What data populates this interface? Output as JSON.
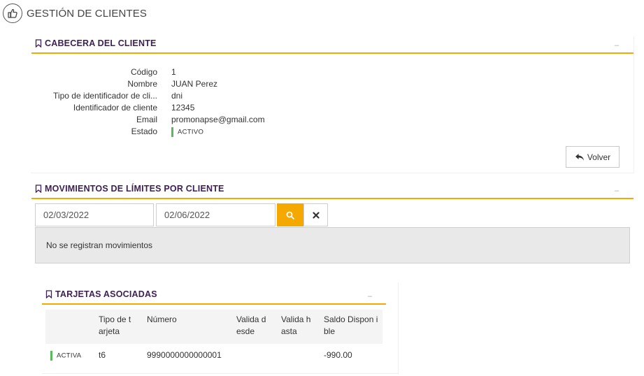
{
  "page": {
    "title": "GESTIÓN DE CLIENTES",
    "icon": "thumbs-up-icon"
  },
  "customer_header": {
    "title": "CABECERA DEL CLIENTE",
    "collapse_label": "–",
    "fields": [
      {
        "label": "Código",
        "value": "1"
      },
      {
        "label": "Nombre",
        "value": "JUAN Perez"
      },
      {
        "label": "Tipo de identificador de cli...",
        "value": "dni"
      },
      {
        "label": "Identificador de cliente",
        "value": "12345"
      },
      {
        "label": "Email",
        "value": "promonapse@gmail.com"
      },
      {
        "label": "Estado",
        "value": "ACTIVO"
      }
    ],
    "status_color": "#5cb85c",
    "back_button": "Volver"
  },
  "movements": {
    "title": "MOVIMIENTOS DE LÍMITES POR CLIENTE",
    "collapse_label": "–",
    "date_from": "02/03/2022",
    "date_to": "02/06/2022",
    "empty_message": "No se registran movimientos"
  },
  "cards": {
    "title": "TARJETAS ASOCIADAS",
    "collapse_label": "–",
    "columns": [
      "Tipo de t arjeta",
      "Número",
      "Valida d esde",
      "Valida h asta",
      "Saldo Dispon ible"
    ],
    "rows": [
      {
        "status": "ACTIVA",
        "type": "t6",
        "number": "9990000000000001",
        "valid_from": "",
        "valid_to": "",
        "balance": "-990.00"
      }
    ]
  },
  "colors": {
    "accent": "#f5a800",
    "title_purple": "#3d1f52",
    "active_green": "#5cb85c"
  }
}
